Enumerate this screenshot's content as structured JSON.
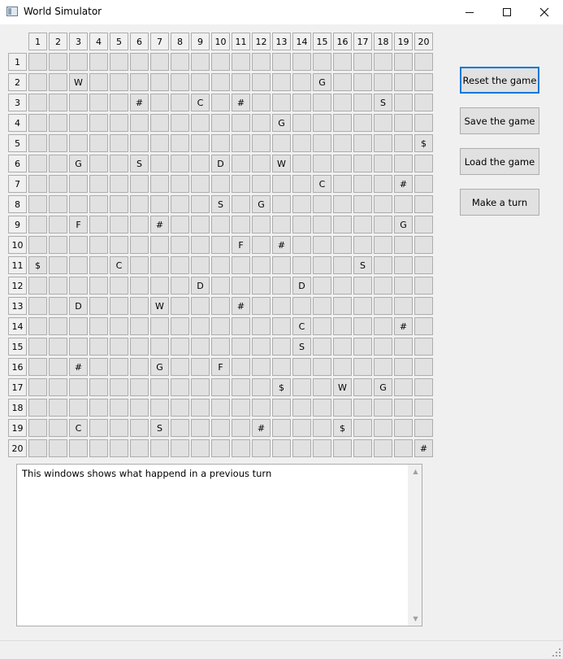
{
  "window": {
    "title": "World Simulator",
    "controls": {
      "minimize": "minimize",
      "maximize": "maximize",
      "close": "close"
    }
  },
  "board": {
    "columns": [
      "1",
      "2",
      "3",
      "4",
      "5",
      "6",
      "7",
      "8",
      "9",
      "10",
      "11",
      "12",
      "13",
      "14",
      "15",
      "16",
      "17",
      "18",
      "19",
      "20"
    ],
    "rows": [
      [
        "",
        "",
        "",
        "",
        "",
        "",
        "",
        "",
        "",
        "",
        "",
        "",
        "",
        "",
        "",
        "",
        "",
        "",
        "",
        ""
      ],
      [
        "",
        "",
        "W",
        "",
        "",
        "",
        "",
        "",
        "",
        "",
        "",
        "",
        "",
        "",
        "G",
        "",
        "",
        "",
        "",
        ""
      ],
      [
        "",
        "",
        "",
        "",
        "",
        "#",
        "",
        "",
        "C",
        "",
        "#",
        "",
        "",
        "",
        "",
        "",
        "",
        "S",
        "",
        ""
      ],
      [
        "",
        "",
        "",
        "",
        "",
        "",
        "",
        "",
        "",
        "",
        "",
        "",
        "G",
        "",
        "",
        "",
        "",
        "",
        "",
        ""
      ],
      [
        "",
        "",
        "",
        "",
        "",
        "",
        "",
        "",
        "",
        "",
        "",
        "",
        "",
        "",
        "",
        "",
        "",
        "",
        "",
        "$"
      ],
      [
        "",
        "",
        "G",
        "",
        "",
        "S",
        "",
        "",
        "",
        "D",
        "",
        "",
        "W",
        "",
        "",
        "",
        "",
        "",
        "",
        ""
      ],
      [
        "",
        "",
        "",
        "",
        "",
        "",
        "",
        "",
        "",
        "",
        "",
        "",
        "",
        "",
        "C",
        "",
        "",
        "",
        "#",
        ""
      ],
      [
        "",
        "",
        "",
        "",
        "",
        "",
        "",
        "",
        "",
        "S",
        "",
        "G",
        "",
        "",
        "",
        "",
        "",
        "",
        "",
        ""
      ],
      [
        "",
        "",
        "F",
        "",
        "",
        "",
        "#",
        "",
        "",
        "",
        "",
        "",
        "",
        "",
        "",
        "",
        "",
        "",
        "G",
        ""
      ],
      [
        "",
        "",
        "",
        "",
        "",
        "",
        "",
        "",
        "",
        "",
        "F",
        "",
        "#",
        "",
        "",
        "",
        "",
        "",
        "",
        ""
      ],
      [
        "$",
        "",
        "",
        "",
        "C",
        "",
        "",
        "",
        "",
        "",
        "",
        "",
        "",
        "",
        "",
        "",
        "S",
        "",
        "",
        ""
      ],
      [
        "",
        "",
        "",
        "",
        "",
        "",
        "",
        "",
        "D",
        "",
        "",
        "",
        "",
        "D",
        "",
        "",
        "",
        "",
        "",
        ""
      ],
      [
        "",
        "",
        "D",
        "",
        "",
        "",
        "W",
        "",
        "",
        "",
        "#",
        "",
        "",
        "",
        "",
        "",
        "",
        "",
        "",
        ""
      ],
      [
        "",
        "",
        "",
        "",
        "",
        "",
        "",
        "",
        "",
        "",
        "",
        "",
        "",
        "C",
        "",
        "",
        "",
        "",
        "#",
        ""
      ],
      [
        "",
        "",
        "",
        "",
        "",
        "",
        "",
        "",
        "",
        "",
        "",
        "",
        "",
        "S",
        "",
        "",
        "",
        "",
        "",
        ""
      ],
      [
        "",
        "",
        "#",
        "",
        "",
        "",
        "G",
        "",
        "",
        "F",
        "",
        "",
        "",
        "",
        "",
        "",
        "",
        "",
        "",
        ""
      ],
      [
        "",
        "",
        "",
        "",
        "",
        "",
        "",
        "",
        "",
        "",
        "",
        "",
        "$",
        "",
        "",
        "W",
        "",
        "G",
        "",
        ""
      ],
      [
        "",
        "",
        "",
        "",
        "",
        "",
        "",
        "",
        "",
        "",
        "",
        "",
        "",
        "",
        "",
        "",
        "",
        "",
        "",
        ""
      ],
      [
        "",
        "",
        "C",
        "",
        "",
        "",
        "S",
        "",
        "",
        "",
        "",
        "#",
        "",
        "",
        "",
        "$",
        "",
        "",
        "",
        ""
      ],
      [
        "",
        "",
        "",
        "",
        "",
        "",
        "",
        "",
        "",
        "",
        "",
        "",
        "",
        "",
        "",
        "",
        "",
        "",
        "",
        "#"
      ]
    ]
  },
  "buttons": {
    "reset": "Reset the game",
    "save": "Save the game",
    "load": "Load the game",
    "turn": "Make a turn"
  },
  "log": {
    "text": "This windows shows what happend in a previous turn"
  }
}
